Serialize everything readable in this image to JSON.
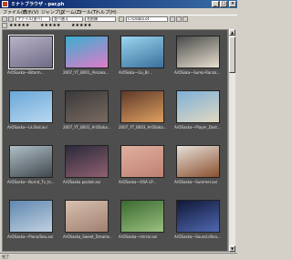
{
  "window": {
    "title": "ミナトブラウザ - par.ph"
  },
  "menu": [
    "ファイル(F)",
    "表示(V)",
    "ジャンプ(J)",
    "ズーム(Z)",
    "ツール(T)",
    "ヘルプ(H)"
  ],
  "toolbar": {
    "combo1": "ファイル(並べ)",
    "combo2": "並べ替え",
    "combo3": "名前順",
    "path": "C:\\Osaka.ot",
    "rating": "★★★★★"
  },
  "thumbnails": [
    {
      "caption": "ArOSaska一Bitorm…",
      "c1": "#b9b3c7",
      "c2": "#6f6a86"
    },
    {
      "caption": "2007_YT_B001_/Arsaka…",
      "c1": "#3aaed0",
      "c2": "#e07bc8"
    },
    {
      "caption": "ArOSaka一Ga_Br…",
      "c1": "#9ad6f0",
      "c2": "#3a6f9c"
    },
    {
      "caption": "ArOSaka一Sumo-Ranzo…",
      "c1": "#4a4a4a",
      "c2": "#e8e0d0"
    },
    {
      "caption": "ArOSaska一Lk.Bsd.avi",
      "c1": "#6aa7d8",
      "c2": "#b8d8f0"
    },
    {
      "caption": "2007_YT_B001_ArOSaka…",
      "c1": "#3a3a3a",
      "c2": "#7a6a60"
    },
    {
      "caption": "2007_YT_B003_ArOSaka…",
      "c1": "#5e3a2a",
      "c2": "#e0a060"
    },
    {
      "caption": "ArOSaska一Player_Dost…",
      "c1": "#7fb0d8",
      "c2": "#e0d8c0"
    },
    {
      "caption": "ArOSaska一Burnd_Tv_ts…",
      "c1": "#b0c0c8",
      "c2": "#40484e"
    },
    {
      "caption": "ArOSaska pocket.avi",
      "c1": "#2a2a3a",
      "c2": "#906070"
    },
    {
      "caption": "ArOSaska一OSA LP…",
      "c1": "#e0b0a0",
      "c2": "#c08070"
    },
    {
      "caption": "ArOSaska一Summer.avi",
      "c1": "#e8e0d8",
      "c2": "#8a5030"
    },
    {
      "caption": "ArOSaska一Piano/Sea.avi",
      "c1": "#6088b0",
      "c2": "#c0d0e0"
    },
    {
      "caption": "ArOSaska_Sweet_Dreams…",
      "c1": "#d8c0b0",
      "c2": "#a08070"
    },
    {
      "caption": "ArOSaska一mirror.avi",
      "c1": "#3a6a30",
      "c2": "#9ac080"
    },
    {
      "caption": "ArOSaska一Sound.dlina…",
      "c1": "#101838",
      "c2": "#5068b0"
    }
  ],
  "status": {
    "text": "完了"
  }
}
